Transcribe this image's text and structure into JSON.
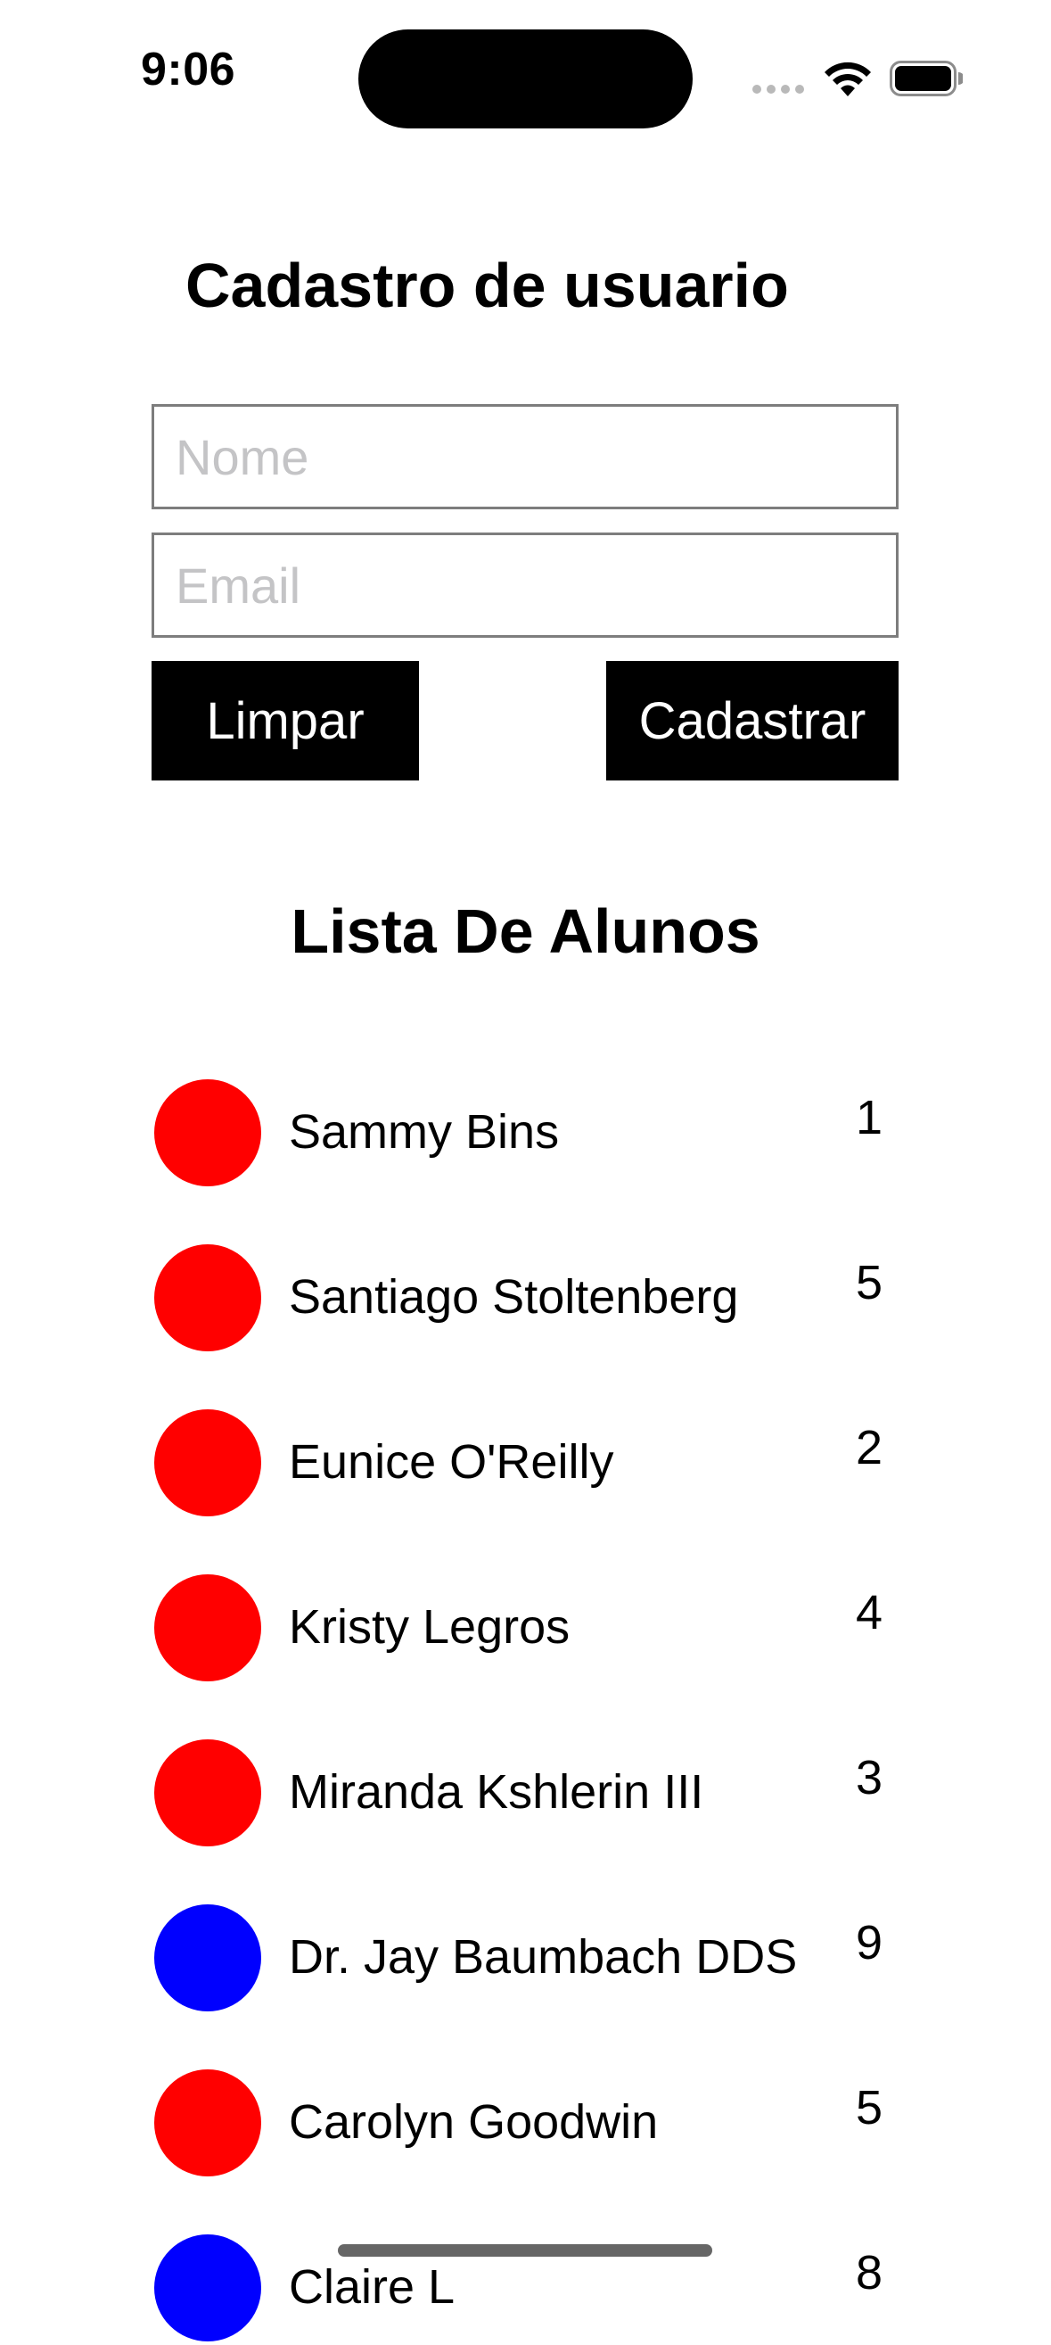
{
  "status_bar": {
    "time": "9:06"
  },
  "form": {
    "title": "Cadastro de usuario",
    "name_placeholder": "Nome",
    "email_placeholder": "Email",
    "clear_label": "Limpar",
    "submit_label": "Cadastrar"
  },
  "list": {
    "title": "Lista De Alunos",
    "students": [
      {
        "name": "Sammy Bins",
        "value": "1",
        "color": "#ff0000"
      },
      {
        "name": "Santiago Stoltenberg",
        "value": "5",
        "color": "#ff0000"
      },
      {
        "name": "Eunice O'Reilly",
        "value": "2",
        "color": "#ff0000"
      },
      {
        "name": "Kristy Legros",
        "value": "4",
        "color": "#ff0000"
      },
      {
        "name": "Miranda Kshlerin III",
        "value": "3",
        "color": "#ff0000"
      },
      {
        "name": "Dr. Jay Baumbach DDS",
        "value": "9",
        "color": "#0000ff"
      },
      {
        "name": "Carolyn Goodwin",
        "value": "5",
        "color": "#ff0000"
      },
      {
        "name": "Claire L",
        "value": "8",
        "color": "#0000ff"
      }
    ]
  },
  "icons": {
    "signal": "cellular-signal-icon",
    "wifi": "wifi-icon",
    "battery": "battery-icon"
  }
}
